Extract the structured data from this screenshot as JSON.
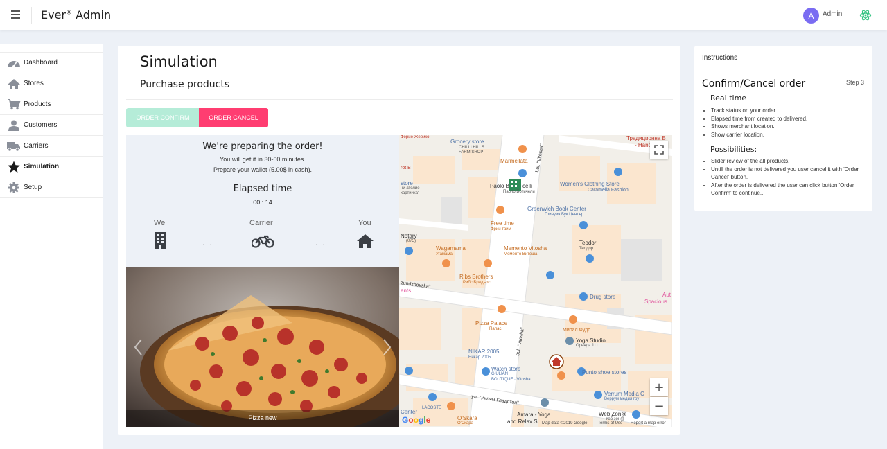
{
  "header": {
    "brand": "Ever",
    "brand_mark": "®",
    "brand_suffix": " Admin",
    "avatar_letter": "A",
    "user_name": "Admin"
  },
  "sidebar": {
    "items": [
      {
        "label": "Dashboard",
        "icon": "dashboard-icon"
      },
      {
        "label": "Stores",
        "icon": "home-icon"
      },
      {
        "label": "Products",
        "icon": "cart-icon"
      },
      {
        "label": "Customers",
        "icon": "person-icon"
      },
      {
        "label": "Carriers",
        "icon": "truck-icon"
      },
      {
        "label": "Simulation",
        "icon": "star-icon",
        "active": true
      },
      {
        "label": "Setup",
        "icon": "gear-icon"
      }
    ]
  },
  "main": {
    "title": "Simulation",
    "subtitle": "Purchase products",
    "confirm_label": "ORDER CONFIRM",
    "cancel_label": "ORDER CANCEL"
  },
  "status": {
    "heading": "We're preparing the order!",
    "line1": "You will get it in 30-60 minutes.",
    "line2": "Prepare your wallet (5.00$ in cash).",
    "elapsed_label": "Elapsed time",
    "elapsed_value": "00 : 14",
    "we_label": "We",
    "carrier_label": "Carrier",
    "you_label": "You",
    "dots": ". ."
  },
  "slider": {
    "caption": "Pizza new"
  },
  "map": {
    "labels": {
      "grocery": "Grocery store",
      "grocery_sub": "CHILLI HILLS",
      "grocery_sub2": "FARM SHOP",
      "marmellata": "Marmellata",
      "paolo": "Paolo B",
      "paolo_b": "celli",
      "paolo_sub": "Паоло Ботичели",
      "womens": "Women's Clothing Store",
      "womens_sub": "Caramella Fashion",
      "greenwich": "Greenwich Book Center",
      "greenwich_sub": "Гринуич Бук Център",
      "freetime": "Free time",
      "freetime_sub": "Фрий тайм",
      "teodor": "Teodor",
      "teodor_sub": "Теодор",
      "wagamama": "Wagamama",
      "wagamama_sub": "Угамама",
      "memento": "Memento Vitosha",
      "memento_sub": "Мементо Витоша",
      "ribs": "Ribs Brothers",
      "ribs_sub": "Рибс Брадърс",
      "drug": "Drug store",
      "pizza_palace": "Pizza Palace",
      "pizza_palace_sub": "Палас",
      "mirage": "Мирал Фудс",
      "yoga": "Yoga Studio",
      "yoga_sub": "Оренда 111",
      "nikar": "NIKAR 2005",
      "nikar_sub": "Никар 2005",
      "watch": "Watch store",
      "watch_sub": "GIULIAN",
      "watch_sub2": "BOUTIQUE · Vitosha",
      "punto": "Punto shoe stores",
      "verrum": "Verrum Media C",
      "verrum_sub": "Веррум медия гру",
      "gladstone": "ул. \"Уилям Гладстон\"",
      "amara": "Amara - Yoga",
      "amara2": "and Relax S",
      "webzone": "Web Zon@",
      "webzone_sub": "Уеб зон@",
      "oskara": "O'Skara",
      "oskara_sub": "О'Скара",
      "lacoste": "LACOSTE",
      "vitosha1": "bul. \"Vitosha\"",
      "vitosha2": "bul. \"Vitosha\"",
      "zundzhovska": "zundzhovska\"",
      "notary": "Notary",
      "notary_sub": "(075)",
      "ferie": "Ферие-Жерико",
      "tradition": "Традиционна Б",
      "tradition_sub": "- Hand B",
      "store": "store",
      "store_sub": "ни ателие",
      "store_sub2": "хартийка\"",
      "spacious": "Spacious",
      "auto": "Aut",
      "ents": "ents",
      "center": "Center",
      "rot_b": "rot B",
      "footer1": "Map data ©2019 Google",
      "footer2": "Terms of Use",
      "footer3": "Report a map error"
    },
    "google": "Google"
  },
  "instructions": {
    "header": "Instructions",
    "title": "Confirm/Cancel order",
    "step": "Step 3",
    "real_time": "Real time",
    "real_time_items": [
      "Track status on your order.",
      "Elapsed time from created to delivered.",
      "Shows merchant location.",
      "Show carrier location."
    ],
    "possibilities": "Possibilities:",
    "possibilities_items": [
      "Slider review of the all products.",
      "Untill the order is not delivered you user cancel it with 'Order Cancel' button.",
      "After the order is delivered the user can click button 'Order Confirm' to continue.."
    ]
  },
  "colors": {
    "accent": "#ff3d71",
    "confirm": "#b5ecd8",
    "avatar": "#7a6cf2",
    "bg": "#edf1f7"
  }
}
